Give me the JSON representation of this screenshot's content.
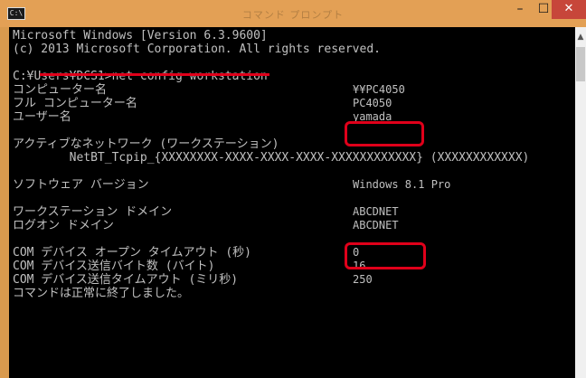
{
  "window": {
    "title": "コマンド プロンプト",
    "controls": {
      "minimize": "–",
      "maximize": "☐",
      "close": "✕"
    },
    "icon": "cmd-icon"
  },
  "console": {
    "lines": [
      "Microsoft Windows [Version 6.3.9600]",
      "(c) 2013 Microsoft Corporation. All rights reserved.",
      "",
      "C:¥Users¥DCS1>net config workstation",
      "コンピューター名",
      "フル コンピューター名",
      "ユーザー名",
      "",
      "アクティブなネットワーク (ワークステーション)",
      "        NetBT_Tcpip_{XXXXXXXX-XXXX-XXXX-XXXX-XXXXXXXXXXXX} (XXXXXXXXXXXX)",
      "",
      "ソフトウェア バージョン",
      "",
      "ワークステーション ドメイン",
      "ログオン ドメイン",
      "",
      "COM デバイス オープン タイムアウト (秒)",
      "COM デバイス送信バイト数 (バイト)",
      "COM デバイス送信タイムアウト (ミリ秒)",
      "コマンドは正常に終了しました。"
    ],
    "values": {
      "computer_name": "¥¥PC4050",
      "full_computer_name": "PC4050",
      "user_name": "yamada",
      "software_version": "Windows 8.1 Pro",
      "workstation_domain": "ABCDNET",
      "logon_domain": "ABCDNET",
      "com_open_timeout": "0",
      "com_send_bytes": "16",
      "com_send_timeout": "250"
    }
  },
  "annotations": {
    "underline_color": "#e0001a",
    "highlight_color": "#e0001a"
  }
}
